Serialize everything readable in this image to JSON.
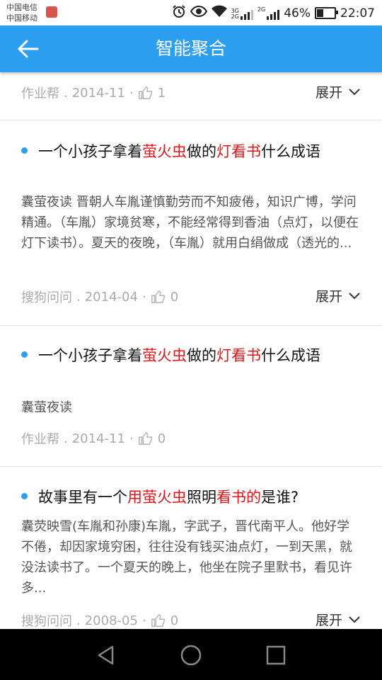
{
  "status_bar": {
    "carrier1": "中国电信",
    "carrier2": "中国移动",
    "net1": "3G",
    "net2": "2G",
    "net3": "2G",
    "battery": "46%",
    "time": "22:07"
  },
  "header": {
    "title": "智能聚合",
    "back_icon": "arrow-left-icon"
  },
  "expand_label": "展开",
  "results": [
    {
      "source": "作业帮",
      "sep": ".",
      "date": "2014-11",
      "dot": "·",
      "likes": "1"
    },
    {
      "title": [
        {
          "t": "一个小孩子拿着",
          "h": false
        },
        {
          "t": "萤火虫",
          "h": true
        },
        {
          "t": "做的",
          "h": false
        },
        {
          "t": "灯看书",
          "h": true
        },
        {
          "t": "什么成语",
          "h": false
        }
      ],
      "summary": "囊萤夜读 晋朝人车胤谨慎勤劳而不知疲倦，知识广博，学问精通。（车胤）家境贫寒，不能经常得到香油（点灯，以便在灯下读书）。夏天的夜晚，（车胤）就用白绢做成（透光的...",
      "source": "搜狗问问",
      "sep": ".",
      "date": "2014-04",
      "dot": "·",
      "likes": "0"
    },
    {
      "title": [
        {
          "t": "一个小孩子拿着",
          "h": false
        },
        {
          "t": "萤火虫",
          "h": true
        },
        {
          "t": "做的",
          "h": false
        },
        {
          "t": "灯看书",
          "h": true
        },
        {
          "t": "什么成语",
          "h": false
        }
      ],
      "summary": "囊萤夜读",
      "source": "作业帮",
      "sep": ".",
      "date": "2014-11",
      "dot": "·",
      "likes": "0"
    },
    {
      "title": [
        {
          "t": "故事里有一个",
          "h": false
        },
        {
          "t": "用萤火虫",
          "h": true
        },
        {
          "t": "照明",
          "h": false
        },
        {
          "t": "看书的",
          "h": true
        },
        {
          "t": "是谁?",
          "h": false
        }
      ],
      "summary": "囊荧映雪(车胤和孙康)车胤，字武子，晋代南平人。他好学不倦，却因家境穷困，往往没有钱买油点灯，一到天黑，就没法读书了。一个夏天的晚上，他坐在院子里默书，看见许多...",
      "source": "搜狗问问",
      "sep": ".",
      "date": "2008-05",
      "dot": "·",
      "likes": "0"
    }
  ],
  "colors": {
    "accent": "#2c9ff0",
    "highlight": "#e4141b"
  },
  "nav_bar": {
    "back": "triangle-back-icon",
    "home": "circle-home-icon",
    "recents": "square-recents-icon"
  }
}
